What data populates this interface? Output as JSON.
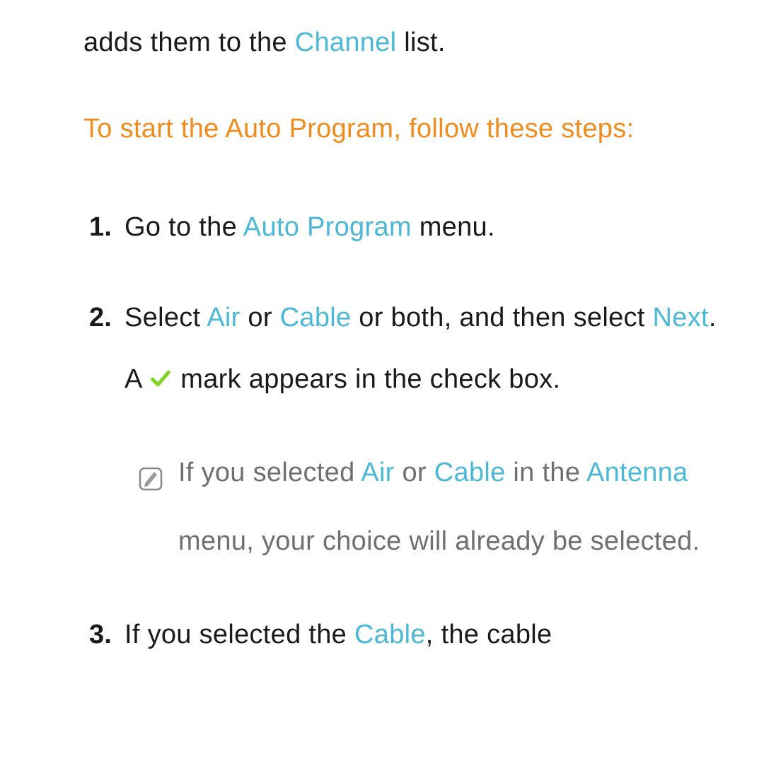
{
  "intro": {
    "pre": "adds them to the ",
    "channel": "Channel",
    "post": " list."
  },
  "heading": "To start the Auto Program, follow these steps:",
  "steps": {
    "s1": {
      "num": "1.",
      "pre": "Go to the ",
      "autoProgram": "Auto Program",
      "post": " menu."
    },
    "s2": {
      "num": "2.",
      "p1a": "Select ",
      "air": "Air",
      "p1b": " or ",
      "cable": "Cable",
      "p1c": " or both, and then select ",
      "next": "Next",
      "p1d": ". A ",
      "p1e": " mark appears in the check box."
    },
    "note": {
      "p1": "If you selected ",
      "air": "Air",
      "p2": " or ",
      "cable": "Cable",
      "p3": " in the ",
      "antenna": "Antenna",
      "p4": " menu, your choice will already be selected."
    },
    "s3": {
      "num": "3.",
      "p1": "If you selected the ",
      "cable": "Cable",
      "p2": ", the cable"
    }
  },
  "colors": {
    "blue": "#4bb8d8",
    "orange": "#f08b1d",
    "check": "#7ed321",
    "noteText": "#6f6f6f",
    "noteIcon": "#888888"
  }
}
